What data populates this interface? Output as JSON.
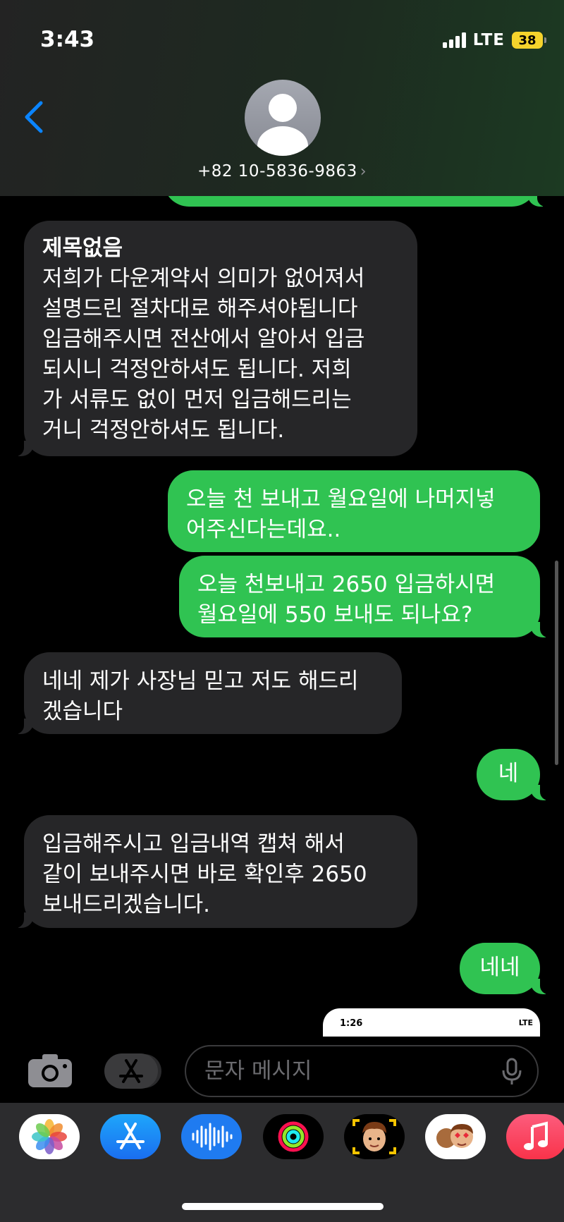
{
  "status_bar": {
    "time": "3:43",
    "network": "LTE",
    "battery": "38"
  },
  "header": {
    "contact": "+82 10-5836-9863",
    "chevron": "›"
  },
  "messages": [
    {
      "direction": "incoming",
      "subject": "제목없음",
      "lines": [
        "저희가 다운계약서 의미가 없어져서",
        "설명드린 절차대로 해주셔야됩니다",
        "입금해주시면 전산에서 알아서 입금",
        "되시니 걱정안하셔도 됩니다. 저희",
        "가 서류도 없이 먼저 입금해드리는",
        "거니 걱정안하셔도 됩니다."
      ]
    },
    {
      "direction": "outgoing",
      "lines": [
        "오늘 천 보내고 월요일에 나머지넣",
        "어주신다는데요.."
      ]
    },
    {
      "direction": "outgoing",
      "lines": [
        "오늘 천보내고 2650 입금하시면",
        "월요일에 550 보내도 되나요?"
      ]
    },
    {
      "direction": "incoming",
      "lines": [
        "네네 제가 사장님 믿고 저도 해드리",
        "겠습니다"
      ]
    },
    {
      "direction": "outgoing",
      "lines": [
        "네"
      ]
    },
    {
      "direction": "incoming",
      "lines": [
        "입금해주시고  입금내역 캡쳐 해서",
        "같이 보내주시면 바로 확인후 2650",
        "보내드리겠습니다."
      ]
    },
    {
      "direction": "outgoing",
      "lines": [
        "네네"
      ]
    }
  ],
  "attachment_preview": {
    "time": "1:26",
    "status": "LTE"
  },
  "composer": {
    "placeholder": "문자 메시지"
  },
  "app_strip": [
    "photos-icon",
    "app-store-icon",
    "audio-message-icon",
    "activity-icon",
    "memoji-icon",
    "memoji-stickers-icon",
    "music-icon"
  ],
  "colors": {
    "outgoing_bubble": "#30c352",
    "incoming_bubble": "#262628",
    "accent": "#0a84ff"
  }
}
